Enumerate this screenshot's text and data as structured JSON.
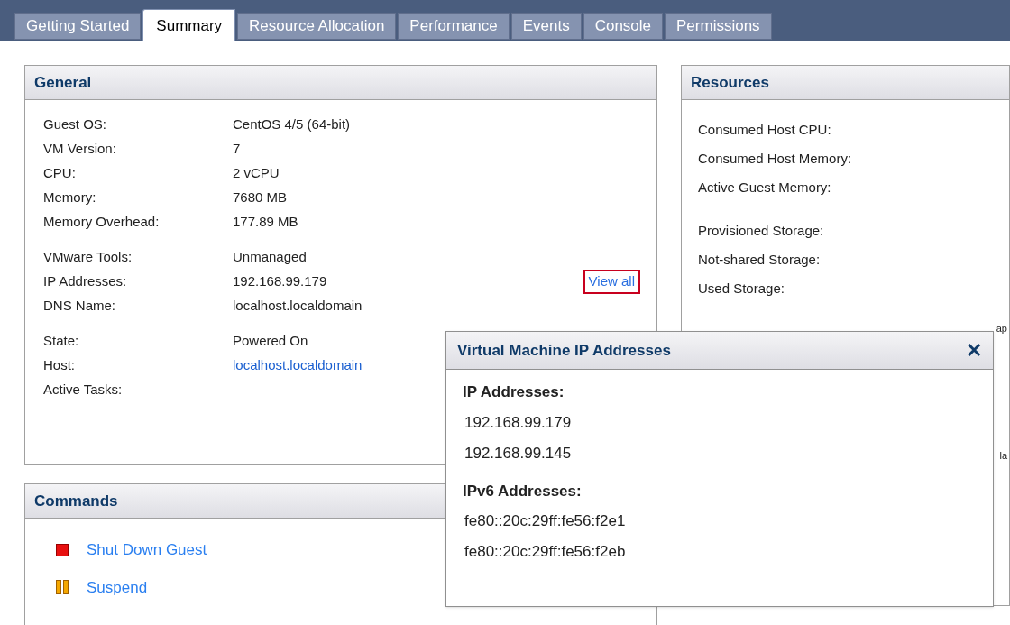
{
  "tabs": [
    {
      "label": "Getting Started",
      "selected": false
    },
    {
      "label": "Summary",
      "selected": true
    },
    {
      "label": "Resource Allocation",
      "selected": false
    },
    {
      "label": "Performance",
      "selected": false
    },
    {
      "label": "Events",
      "selected": false
    },
    {
      "label": "Console",
      "selected": false
    },
    {
      "label": "Permissions",
      "selected": false
    }
  ],
  "general": {
    "title": "General",
    "groups": [
      [
        {
          "label": "Guest OS:",
          "value": "CentOS 4/5 (64-bit)",
          "kind": "text"
        },
        {
          "label": "VM Version:",
          "value": "7",
          "kind": "text"
        },
        {
          "label": "CPU:",
          "value": "2 vCPU",
          "kind": "text"
        },
        {
          "label": "Memory:",
          "value": "7680 MB",
          "kind": "text"
        },
        {
          "label": "Memory Overhead:",
          "value": "177.89 MB",
          "kind": "text"
        }
      ],
      [
        {
          "label": "VMware Tools:",
          "value": "Unmanaged",
          "kind": "text"
        },
        {
          "label": "IP Addresses:",
          "value": "192.168.99.179",
          "kind": "text",
          "action": "View all"
        },
        {
          "label": "DNS Name:",
          "value": "localhost.localdomain",
          "kind": "text"
        }
      ],
      [
        {
          "label": "State:",
          "value": "Powered On",
          "kind": "text"
        },
        {
          "label": "Host:",
          "value": "localhost.localdomain",
          "kind": "link"
        },
        {
          "label": "Active Tasks:"
        }
      ]
    ]
  },
  "resources": {
    "title": "Resources",
    "groups": [
      [
        "Consumed Host CPU:",
        "Consumed Host Memory:",
        "Active Guest Memory:"
      ],
      [
        "Provisioned Storage:",
        "Not-shared Storage:",
        "Used Storage:"
      ]
    ],
    "hidden_fragments": [
      "ap",
      "la"
    ]
  },
  "commands": {
    "title": "Commands",
    "items": [
      {
        "label": "Shut Down Guest",
        "kind": "stop"
      },
      {
        "label": "Suspend",
        "kind": "pause"
      }
    ]
  },
  "popup": {
    "title": "Virtual Machine IP Addresses",
    "close": "✕",
    "sections": [
      {
        "heading": "IP Addresses:",
        "items": [
          "192.168.99.179",
          "192.168.99.145"
        ]
      },
      {
        "heading": "IPv6 Addresses:",
        "items": [
          "fe80::20c:29ff:fe56:f2e1",
          "fe80::20c:29ff:fe56:f2eb"
        ]
      }
    ]
  }
}
